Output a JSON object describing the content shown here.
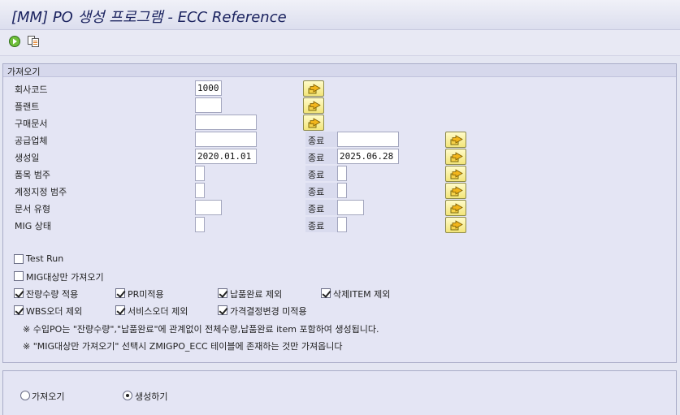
{
  "window": {
    "title": "[MM] PO 생성 프로그램 - ECC Reference"
  },
  "toolbar": {
    "execute_icon": "execute-icon",
    "variant_icon": "variant-icon"
  },
  "group": {
    "title": "가져오기"
  },
  "fields": [
    {
      "label": "회사코드",
      "from": "1000",
      "to": null
    },
    {
      "label": "플랜트",
      "from": "",
      "to": null
    },
    {
      "label": "구매문서",
      "from": "",
      "to": null
    },
    {
      "label": "공급업체",
      "from": "",
      "to": ""
    },
    {
      "label": "생성일",
      "from": "2020.01.01",
      "to": "2025.06.28"
    },
    {
      "label": "품목 범주",
      "from": "",
      "to": ""
    },
    {
      "label": "계정지정 범주",
      "from": "",
      "to": ""
    },
    {
      "label": "문서 유형",
      "from": "",
      "to": ""
    },
    {
      "label": "MIG 상태",
      "from": "",
      "to": ""
    }
  ],
  "to_label": "종료",
  "checkboxes": {
    "test_run": {
      "label": "Test Run",
      "checked": false
    },
    "mig_only": {
      "label": "MIG대상만 가져오기",
      "checked": false
    },
    "remaining_qty": {
      "label": "잔량수량 적용",
      "checked": true
    },
    "pr_not_applied": {
      "label": "PR미적용",
      "checked": true
    },
    "exclude_delivered": {
      "label": "납품완료 제외",
      "checked": true
    },
    "exclude_deleted_item": {
      "label": "삭제ITEM 제외",
      "checked": true
    },
    "exclude_wbs_order": {
      "label": "WBS오더 제외",
      "checked": true
    },
    "exclude_service_order": {
      "label": "서비스오더 제외",
      "checked": true
    },
    "price_change_not_applied": {
      "label": "가격결정변경 미적용",
      "checked": true
    }
  },
  "notes": [
    "※ 수입PO는 \"잔량수량\",\"납품완료\"에 관계없이 전체수량,납품완료 item 포함하여 생성됩니다.",
    "※ \"MIG대상만 가져오기\" 선택시 ZMIGPO_ECC 테이블에 존재하는 것만 가져옵니다"
  ],
  "radios": {
    "fetch": {
      "label": "가져오기",
      "selected": false
    },
    "create": {
      "label": "생성하기",
      "selected": true
    }
  }
}
